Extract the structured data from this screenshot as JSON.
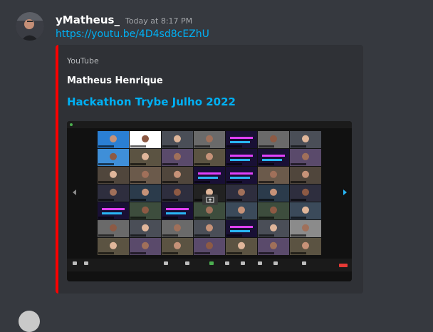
{
  "message": {
    "username": "yMatheus_",
    "timestamp": "Today at 8:17 PM",
    "link": "https://youtu.be/4D4sd8cEZhU"
  },
  "embed": {
    "provider": "YouTube",
    "author": "Matheus Henrique",
    "title": "Hackathon Trybe Julho 2022",
    "accent_color": "#ff0000"
  },
  "video": {
    "grid_rows": 7,
    "grid_cols": 7
  },
  "icons": [
    "avatar",
    "left-arrow-icon",
    "right-arrow-icon",
    "play-icon",
    "end-button"
  ]
}
